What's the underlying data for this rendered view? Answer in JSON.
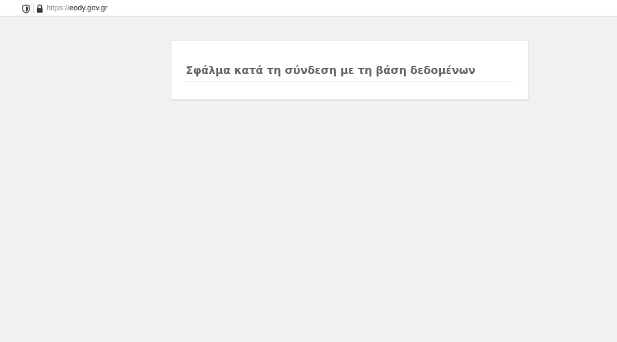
{
  "browser": {
    "url_scheme": "https://",
    "url_host": "eody.gov.gr",
    "icons": {
      "shield": "shield-icon",
      "lock": "lock-icon"
    }
  },
  "page": {
    "error_title": "Σφάλμα κατά τη σύνδεση με τη βάση δεδομένων"
  },
  "colors": {
    "page_background": "#f1f1f1",
    "card_background": "#ffffff",
    "title_text": "#666666"
  }
}
